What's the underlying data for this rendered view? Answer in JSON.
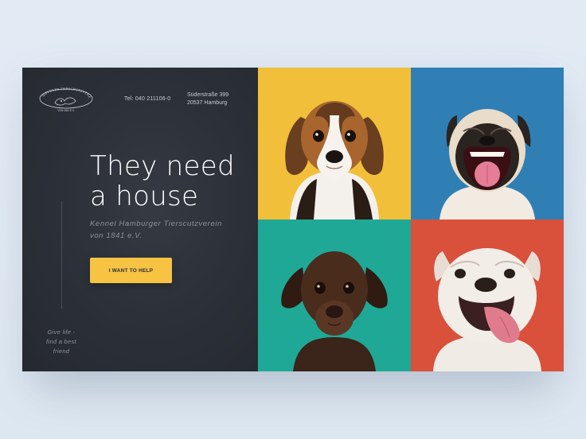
{
  "brand": {
    "logo_text": "HAMBURGER TIERSCHUTZVEREIN",
    "logo_subtext": "VON 1841 E.V."
  },
  "contact": {
    "phone": "Tel: 040 211106-0",
    "street": "Süderstraße 399",
    "city": "20537 Hamburg"
  },
  "hero": {
    "headline_line1": "They need",
    "headline_line2": "a house",
    "subtitle_line1": "Kennel Hamburger Tierscutzverein",
    "subtitle_line2": "von 1841 e.V.",
    "cta_label": "I WANT TO HELP"
  },
  "tagline": {
    "line1": "Give life -",
    "line2": "find a best",
    "line3": "friend"
  },
  "tiles": [
    {
      "name": "beagle-puppy",
      "background": "#f2bf3a"
    },
    {
      "name": "pug-puppy",
      "background": "#2f7fb5"
    },
    {
      "name": "labrador-puppy",
      "background": "#1fa895"
    },
    {
      "name": "bulldog-puppy",
      "background": "#d9503b"
    }
  ],
  "colors": {
    "panel": "#2b2f37",
    "accent": "#f6c343",
    "text_muted": "#8e939b"
  }
}
